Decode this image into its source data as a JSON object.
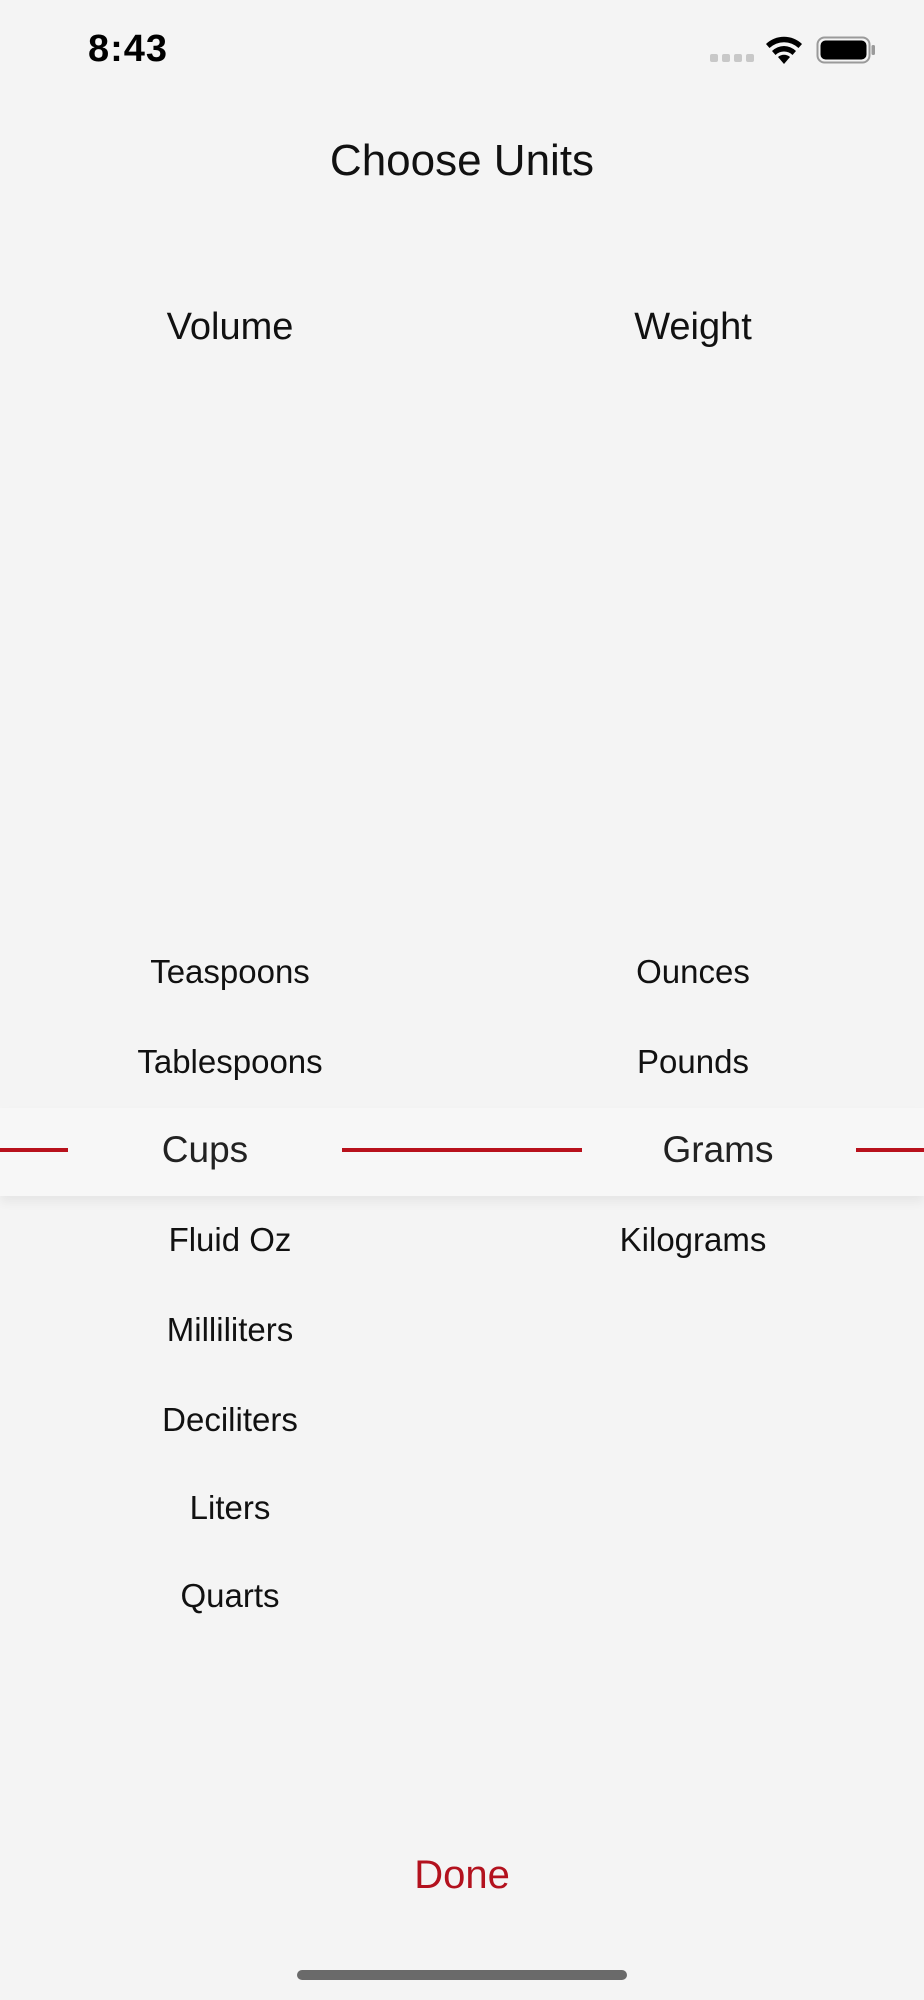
{
  "status_bar": {
    "time": "8:43",
    "icons": [
      "cellular-signal-icon",
      "wifi-icon",
      "battery-icon"
    ]
  },
  "title": "Choose Units",
  "columns": {
    "volume": {
      "header": "Volume",
      "above": [
        "Teaspoons",
        "Tablespoons"
      ],
      "selected": "Cups",
      "below": [
        "Fluid Oz",
        "Milliliters",
        "Deciliters",
        "Liters",
        "Quarts"
      ]
    },
    "weight": {
      "header": "Weight",
      "above": [
        "Ounces",
        "Pounds"
      ],
      "selected": "Grams",
      "below": [
        "Kilograms"
      ]
    }
  },
  "done_label": "Done",
  "colors": {
    "accent": "#b3121e",
    "background": "#f4f4f4",
    "text": "#111111"
  }
}
